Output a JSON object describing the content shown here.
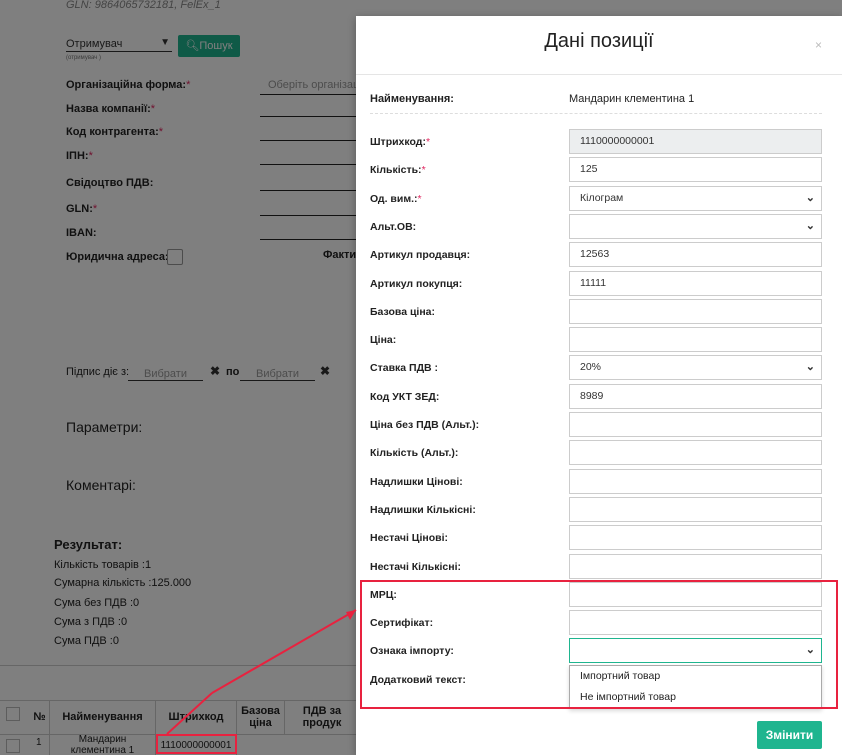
{
  "background": {
    "gln_text": "GLN: 9864065732181, FelEx_1",
    "receiver_select": "Отримувач",
    "receiver_sub": "(отримувач )",
    "search_button": "Пошук",
    "org_form_label": "Організаційна форма:",
    "org_form_placeholder": "Оберіть організаці",
    "company_name_label": "Назва компанії:",
    "counterparty_code_label": "Код контрагента:",
    "ipn_label": "ІПН:",
    "vat_cert_label": "Свідоцтво ПДВ:",
    "gln_label": "GLN:",
    "iban_label": "IBAN:",
    "legal_address_label": "Юридична адреса:",
    "actual_label": "Факти",
    "sign_valid_from": "Підпис діє з:",
    "choose1": "Вибрати",
    "to_label": "по",
    "choose2": "Вибрати",
    "params_label": "Параметри:",
    "comments_label": "Коментарі:",
    "result_title": "Результат:",
    "result_lines": [
      "Кількість товарів :1",
      "Сумарна кількість :125.000",
      "Сума без ПДВ :0",
      "Сума з ПДВ :0",
      "Сума ПДВ :0"
    ],
    "table": {
      "headers": [
        "№",
        "Найменування",
        "Штрихкод",
        "Базова ціна",
        "ПДВ за продук"
      ],
      "row": [
        "1",
        "Мандарин клементина 1",
        "1110000000001"
      ]
    }
  },
  "modal": {
    "title": "Дані позиції",
    "close": "×",
    "name_label": "Найменування:",
    "name_value": "Мандарин клементина 1",
    "rows": [
      {
        "label": "Штрихкод:",
        "required": true,
        "value": "1110000000001",
        "type": "readonly"
      },
      {
        "label": "Кількість:",
        "required": true,
        "value": "125",
        "type": "input"
      },
      {
        "label": "Од. вим.:",
        "required": true,
        "value": "Кілограм",
        "type": "select"
      },
      {
        "label": "Альт.ОВ:",
        "required": false,
        "value": "",
        "type": "select"
      },
      {
        "label": "Артикул продавця:",
        "required": false,
        "value": "12563",
        "type": "input"
      },
      {
        "label": "Артикул покупця:",
        "required": false,
        "value": "11111",
        "type": "input"
      },
      {
        "label": "Базова ціна:",
        "required": false,
        "value": "",
        "type": "input"
      },
      {
        "label": "Ціна:",
        "required": false,
        "value": "",
        "type": "input"
      },
      {
        "label": "Ставка ПДВ :",
        "required": false,
        "value": "20%",
        "type": "select"
      },
      {
        "label": "Код УКТ ЗЕД:",
        "required": false,
        "value": "8989",
        "type": "input"
      },
      {
        "label": "Ціна без ПДВ (Альт.):",
        "required": false,
        "value": "",
        "type": "input"
      },
      {
        "label": "Кількість (Альт.):",
        "required": false,
        "value": "",
        "type": "input"
      },
      {
        "label": "Надлишки Цінові:",
        "required": false,
        "value": "",
        "type": "input"
      },
      {
        "label": "Надлишки Кількісні:",
        "required": false,
        "value": "",
        "type": "input"
      },
      {
        "label": "Нестачі Цінові:",
        "required": false,
        "value": "",
        "type": "input"
      },
      {
        "label": "Нестачі Кількісні:",
        "required": false,
        "value": "",
        "type": "input"
      },
      {
        "label": "МРЦ:",
        "required": false,
        "value": "",
        "type": "input"
      },
      {
        "label": "Сертифікат:",
        "required": false,
        "value": "",
        "type": "input"
      },
      {
        "label": "Ознака імпорту:",
        "required": false,
        "value": "",
        "type": "select-open"
      },
      {
        "label": "Додатковий текст:",
        "required": false,
        "value": "",
        "type": "hidden"
      }
    ],
    "dropdown_options": [
      "Імпортний товар",
      "Не імпортний товар"
    ],
    "submit_button": "Змінити"
  },
  "colors": {
    "accent": "#1fb58f",
    "highlight": "#e8223f",
    "required": "#e0245e"
  }
}
